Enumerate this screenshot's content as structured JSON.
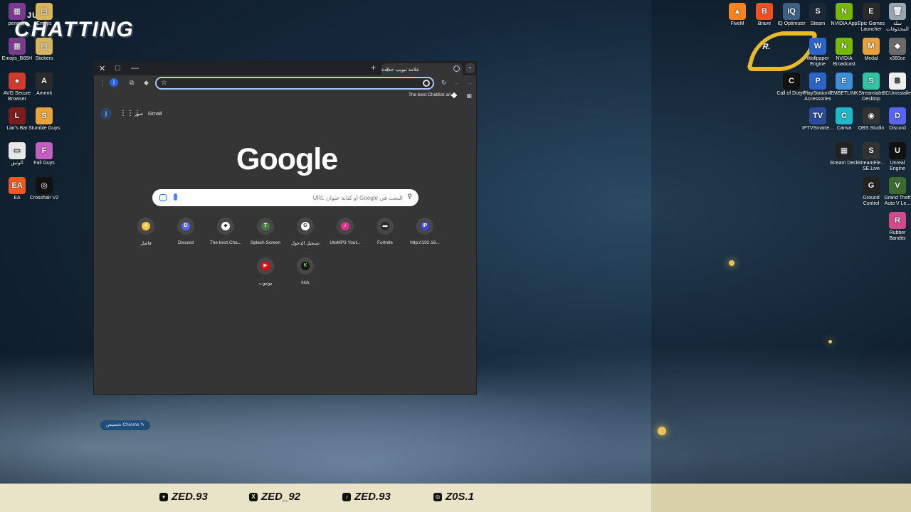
{
  "overlay": {
    "logo_small": "JUST",
    "logo_big": "CHATTING",
    "badge_text": "R.",
    "socials": [
      {
        "icon": "snapchat-icon",
        "glyph": "♦",
        "handle": "ZED.93"
      },
      {
        "icon": "x-icon",
        "glyph": "X",
        "handle": "ZED_92"
      },
      {
        "icon": "tiktok-icon",
        "glyph": "♪",
        "handle": "ZED.93"
      },
      {
        "icon": "instagram-icon",
        "glyph": "◎",
        "handle": "Z0S.1"
      }
    ]
  },
  "desktop_left": [
    {
      "label": "penguin",
      "color": "#7a3b8f",
      "glyph": "▦"
    },
    {
      "label": "Emojis",
      "color": "#d8b45a",
      "glyph": "▤"
    },
    {
      "label": "Emojis_B65H",
      "color": "#7a3b8f",
      "glyph": "▦"
    },
    {
      "label": "Stickers",
      "color": "#d8b45a",
      "glyph": "▤"
    },
    {
      "label": "AVG Secure Browser",
      "color": "#d13b2f",
      "glyph": "●"
    },
    {
      "label": "Amenti",
      "color": "#2a2a2a",
      "glyph": "A"
    },
    {
      "label": "Liar's Bar",
      "color": "#7a1d1d",
      "glyph": "L"
    },
    {
      "label": "Stumble Guys",
      "color": "#e8a33a",
      "glyph": "S"
    },
    {
      "label": "الوثيق",
      "color": "#e8e8e8",
      "glyph": "▭"
    },
    {
      "label": "Fall Guys",
      "color": "#c55fbf",
      "glyph": "F"
    },
    {
      "label": "EA",
      "color": "#f05a22",
      "glyph": "EA"
    },
    {
      "label": "Crosshair V2",
      "color": "#111111",
      "glyph": "◎"
    }
  ],
  "desktop_right": [
    {
      "label": "FiveM",
      "color": "#f5841f",
      "glyph": "▲"
    },
    {
      "label": "Brave",
      "color": "#f04f23",
      "glyph": "B"
    },
    {
      "label": "IQ Optimizer",
      "color": "#3d5f84",
      "glyph": "iQ"
    },
    {
      "label": "Steam",
      "color": "#1b2838",
      "glyph": "S"
    },
    {
      "label": "NVIDIA App",
      "color": "#76b900",
      "glyph": "N"
    },
    {
      "label": "Epic Games Launcher",
      "color": "#2a2a2a",
      "glyph": "E"
    },
    {
      "label": "سلة المحذوفات",
      "color": "#9aa4b0",
      "glyph": "🗑"
    },
    {
      "label": "Wallpaper Engine",
      "color": "#2b65c8",
      "glyph": "W"
    },
    {
      "label": "NVIDIA Broadcast",
      "color": "#76b900",
      "glyph": "N"
    },
    {
      "label": "Medal",
      "color": "#e6a13c",
      "glyph": "M"
    },
    {
      "label": "x360ce",
      "color": "#6a6a6a",
      "glyph": "◆"
    },
    {
      "label": "Call of Duty®",
      "color": "#111111",
      "glyph": "C"
    },
    {
      "label": "PlayStation® Accessories",
      "color": "#2b65c8",
      "glyph": "P"
    },
    {
      "label": "EMBETLINK",
      "color": "#3f8fd8",
      "glyph": "E"
    },
    {
      "label": "Streamlabs Desktop",
      "color": "#31c3a2",
      "glyph": "S"
    },
    {
      "label": "BCUninstaller",
      "color": "#eeeeee",
      "glyph": "B"
    },
    {
      "label": "IPTVSmarte...",
      "color": "#2c4a9a",
      "glyph": "TV"
    },
    {
      "label": "Canva",
      "color": "#1fb8c9",
      "glyph": "C"
    },
    {
      "label": "OBS Studio",
      "color": "#333333",
      "glyph": "◉"
    },
    {
      "label": "Discord",
      "color": "#5865f2",
      "glyph": "D"
    },
    {
      "label": "Stream Deck",
      "color": "#222222",
      "glyph": "▦"
    },
    {
      "label": "StreamEle... SE.Live",
      "color": "#333333",
      "glyph": "S"
    },
    {
      "label": "Unreal Engine",
      "color": "#111111",
      "glyph": "U"
    },
    {
      "label": "Ground Control",
      "color": "#222222",
      "glyph": "G"
    },
    {
      "label": "Grand Theft Auto V Le...",
      "color": "#3b6b2e",
      "glyph": "V"
    },
    {
      "label": "Rubber Bandits",
      "color": "#d14a8a",
      "glyph": "R"
    }
  ],
  "browser": {
    "tab_title": "علامة تبويب جديدة",
    "tab_close": "×",
    "new_tab": "+",
    "tab_menu": "⌄",
    "window_close": "✕",
    "window_max": "□",
    "window_min": "—",
    "menu_dots": "⋮",
    "profile_initial": "j",
    "omnibox_value": "",
    "bookmark_label": "The best ChatBot ari...",
    "ntp": {
      "avatar": "j",
      "link_images": "صور",
      "link_gmail": "Gmail",
      "logo": "Google",
      "search_placeholder": "البحث في Google أو كتابة عنوان URL",
      "shortcuts": [
        {
          "label": "فاصل",
          "color": "#f4c542",
          "glyph": "●"
        },
        {
          "label": "Discord",
          "color": "#5865f2",
          "glyph": "D"
        },
        {
          "label": "The best Cha...",
          "color": "#ffffff",
          "glyph": "◆"
        },
        {
          "label": "Splash Screen",
          "color": "#4a7a4a",
          "glyph": "T"
        },
        {
          "label": "تسجيل الدخول",
          "color": "#ffffff",
          "glyph": "G"
        },
        {
          "label": "UtoMP3 Yout...",
          "color": "#e0338d",
          "glyph": "♪"
        },
        {
          "label": "Fortnite",
          "color": "#2a2a2a",
          "glyph": "▬"
        },
        {
          "label": "http://192.16...",
          "color": "#3b44d6",
          "glyph": "IP"
        },
        {
          "label": "يوتيوب",
          "color": "#ff0000",
          "glyph": "▶"
        },
        {
          "label": "kick",
          "color": "#111111",
          "glyph": "K"
        }
      ],
      "customize_label": "تخصيص Chrome"
    }
  },
  "colors": {
    "accent": "#a8c7fa",
    "kick_green": "#53fc18",
    "overlay_bar": "#e9e4c8",
    "badge_gold": "#e8b92b"
  }
}
